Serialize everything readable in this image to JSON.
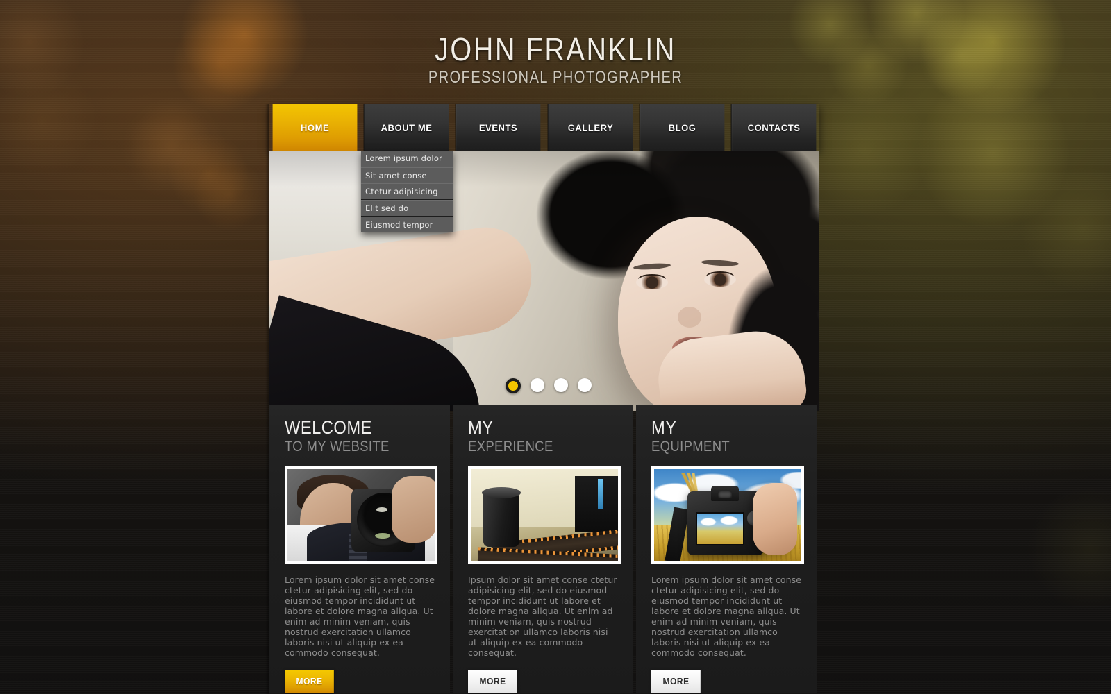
{
  "header": {
    "logo_main": "JOHN FRANKLIN",
    "logo_sub": "PROFESSIONAL PHOTOGRAPHER"
  },
  "nav": {
    "items": [
      {
        "label": "HOME",
        "active": true
      },
      {
        "label": "ABOUT ME",
        "active": false
      },
      {
        "label": "EVENTS",
        "active": false
      },
      {
        "label": "GALLERY",
        "active": false
      },
      {
        "label": "BLOG",
        "active": false
      },
      {
        "label": "CONTACTS",
        "active": false
      }
    ]
  },
  "dropdown": {
    "parent": "ABOUT ME",
    "items": [
      {
        "label": "Lorem ipsum dolor"
      },
      {
        "label": "Sit amet conse"
      },
      {
        "label": "Ctetur adipisicing"
      },
      {
        "label": "Elit sed do"
      },
      {
        "label": "Eiusmod tempor"
      }
    ]
  },
  "slider": {
    "image_alt": "Portrait of a woman with dark curly hair posing with arm raised",
    "pager": [
      {
        "index": "1",
        "active": true
      },
      {
        "index": "2",
        "active": false
      },
      {
        "index": "3",
        "active": false
      },
      {
        "index": "4",
        "active": false
      }
    ]
  },
  "columns": [
    {
      "heading": "WELCOME",
      "subheading": "TO MY WEBSITE",
      "image_alt": "Photographer shooting with a DSLR camera held to his eye",
      "text": "Lorem ipsum dolor sit amet conse ctetur adipisicing elit, sed do eiusmod tempor incididunt ut labore et dolore magna aliqua. Ut enim ad minim veniam, quis nostrud exercitation ullamco laboris nisi ut aliquip ex ea commodo consequat.",
      "button": "MORE",
      "button_style": "gold"
    },
    {
      "heading": "MY",
      "subheading": "EXPERIENCE",
      "image_alt": "Film canister with 35mm film strips on a table",
      "text": "Ipsum dolor sit amet conse ctetur adipisicing elit, sed do eiusmod tempor incididunt ut labore et dolore magna aliqua. Ut enim ad minim veniam, quis nostrud exercitation ullamco laboris nisi ut aliquip ex ea commodo consequat.",
      "button": "MORE",
      "button_style": "light"
    },
    {
      "heading": "MY",
      "subheading": "EQUIPMENT",
      "image_alt": "Hand holding a DSLR camera in front of a wheat field and cloudy sky",
      "text": "Lorem ipsum dolor sit amet conse ctetur adipisicing elit, sed do eiusmod tempor incididunt ut labore et dolore magna aliqua. Ut enim ad minim veniam, quis nostrud exercitation ullamco laboris nisi ut aliquip ex ea commodo consequat.",
      "button": "MORE",
      "button_style": "light"
    }
  ],
  "colors": {
    "accent_gold": "#f2c400",
    "nav_dark": "#2e2e2e",
    "panel_dark": "#1e1e1e",
    "body_text": "#8d8d8d",
    "heading_text": "#f0efed"
  }
}
